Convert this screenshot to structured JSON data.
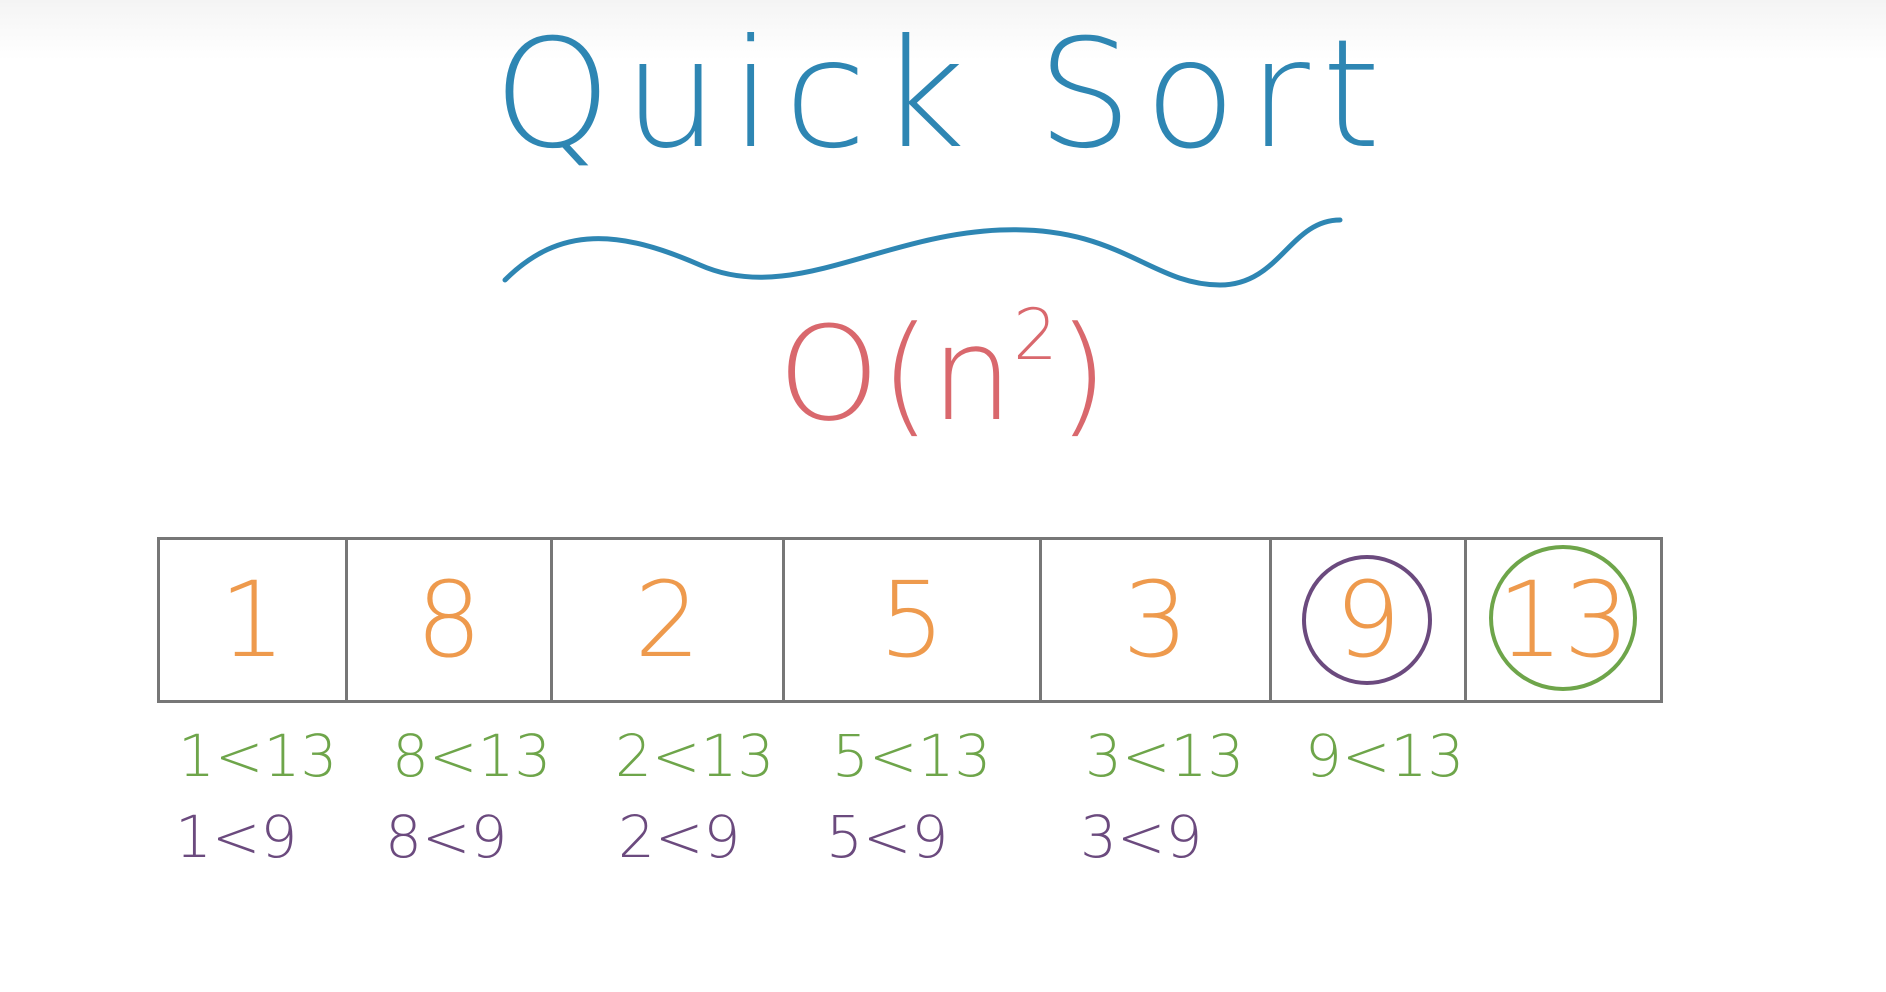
{
  "title": "Quick Sort",
  "complexity": {
    "base": "O(n",
    "exponent": "2",
    "close": ")"
  },
  "array": [
    {
      "value": "1"
    },
    {
      "value": "8"
    },
    {
      "value": "2"
    },
    {
      "value": "5"
    },
    {
      "value": "3"
    },
    {
      "value": "9",
      "marker": "purple-circle"
    },
    {
      "value": "13",
      "marker": "green-circle"
    }
  ],
  "comparisons_pivot_13": [
    "1<13",
    "8<13",
    "2<13",
    "5<13",
    "3<13",
    "9<13"
  ],
  "comparisons_pivot_9": [
    "1<9",
    "8<9",
    "2<9",
    "5<9",
    "3<9"
  ],
  "colors": {
    "title": "#2e86b3",
    "complexity": "#d9686d",
    "values": "#ee9a4d",
    "pivot_13": "#6ea54a",
    "pivot_9": "#6b4a7e",
    "grid": "#777777"
  }
}
